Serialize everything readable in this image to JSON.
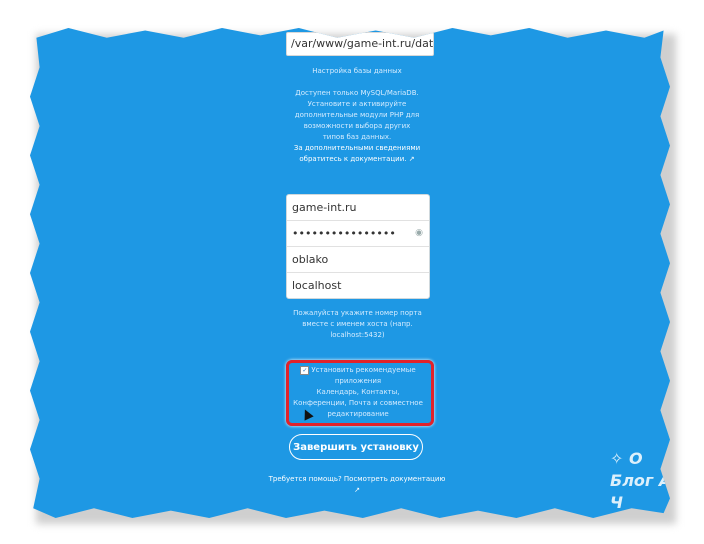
{
  "setup": {
    "data_path": "/var/www/game-int.ru/data/",
    "db_section_label": "Настройка базы данных",
    "db_info": "Доступен только MySQL/MariaDB. Установите и активируйте дополнительные модули PHP для возможности выбора других типов баз данных.",
    "docs_link": "За дополнительными сведениями обратитесь к документации. ↗",
    "db_user": "game-int.ru",
    "db_password_masked": "••••••••••••••••",
    "db_name": "oblako",
    "db_host": "localhost",
    "port_note": "Пожалуйста укажите номер порта вместе с именем хоста (напр. localhost:5432)",
    "recommended_label": "Установить рекомендуемые приложения",
    "recommended_apps": "Календарь, Контакты, Конференции, Почта и совместное редактирование",
    "finish_button": "Завершить установку",
    "help_text": "Требуется помощь? Посмотреть документацию ↗"
  },
  "watermark": {
    "line1": "✧ О",
    "line2": "Блог А",
    "line3": "Ч"
  },
  "colors": {
    "background": "#1e98e4",
    "highlight": "#e2222a"
  }
}
